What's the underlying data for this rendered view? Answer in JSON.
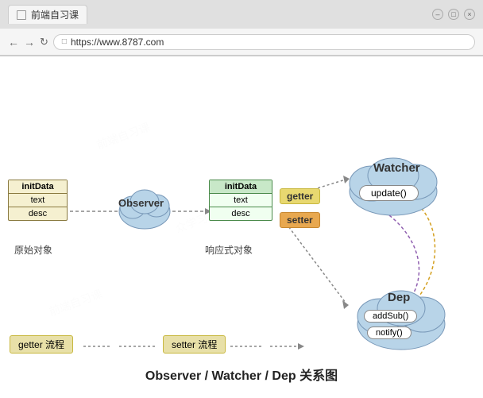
{
  "browser": {
    "tab_title": "前端自习课",
    "url": "https://www.8787.com",
    "window_controls": [
      "○",
      "○",
      "○"
    ]
  },
  "diagram": {
    "title": "Observer / Watcher / Dep 关系图",
    "original_object": {
      "label": "原始对象",
      "header": "initData",
      "rows": [
        "text",
        "desc"
      ]
    },
    "observer": {
      "label": "Observer"
    },
    "reactive_object": {
      "label": "响应式对象",
      "header": "initData",
      "rows": [
        "text",
        "desc"
      ]
    },
    "getter_badge": "getter",
    "setter_badge": "setter",
    "watcher": {
      "label": "Watcher",
      "method": "update()"
    },
    "dep": {
      "label": "Dep",
      "methods": [
        "addSub()",
        "notify()"
      ]
    },
    "flow": {
      "getter_flow": "getter 流程",
      "setter_flow": "setter 流程"
    }
  },
  "watermarks": [
    "前端自习课",
    "众学习",
    "前端自习课"
  ]
}
